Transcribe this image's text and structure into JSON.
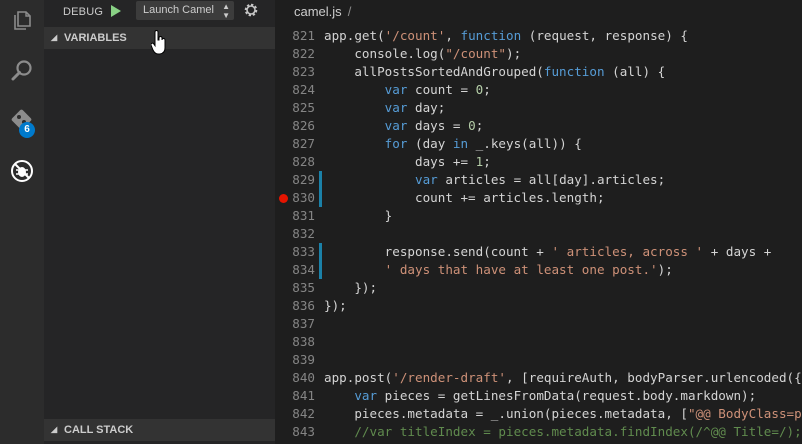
{
  "activity_bar": {
    "items": [
      {
        "icon": "files-icon"
      },
      {
        "icon": "search-icon"
      },
      {
        "icon": "git-icon",
        "badge": "6"
      },
      {
        "icon": "debug-icon"
      }
    ]
  },
  "debug": {
    "title": "DEBUG",
    "configuration": "Launch Camel",
    "sections": {
      "variables": "VARIABLES",
      "call_stack": "CALL STACK"
    }
  },
  "editor": {
    "filename": "camel.js",
    "breadcrumb_sep": "/",
    "breakpoint_line": "830",
    "lines": [
      {
        "n": "821",
        "t": "app.get('/count', function (request, response) {"
      },
      {
        "n": "822",
        "t": "    console.log(\"/count\");"
      },
      {
        "n": "823",
        "t": "    allPostsSortedAndGrouped(function (all) {"
      },
      {
        "n": "824",
        "t": "        var count = 0;"
      },
      {
        "n": "825",
        "t": "        var day;"
      },
      {
        "n": "826",
        "t": "        var days = 0;"
      },
      {
        "n": "827",
        "t": "        for (day in _.keys(all)) {"
      },
      {
        "n": "828",
        "t": "            days += 1;"
      },
      {
        "n": "829",
        "t": "            var articles = all[day].articles;"
      },
      {
        "n": "830",
        "t": "            count += articles.length;"
      },
      {
        "n": "831",
        "t": "        }"
      },
      {
        "n": "832",
        "t": ""
      },
      {
        "n": "833",
        "t": "        response.send(count + ' articles, across ' + days +"
      },
      {
        "n": "834",
        "t": "        ' days that have at least one post.');"
      },
      {
        "n": "835",
        "t": "    });"
      },
      {
        "n": "836",
        "t": "});"
      },
      {
        "n": "837",
        "t": ""
      },
      {
        "n": "838",
        "t": ""
      },
      {
        "n": "839",
        "t": ""
      },
      {
        "n": "840",
        "t": "app.post('/render-draft', [requireAuth, bodyParser.urlencoded({ ext"
      },
      {
        "n": "841",
        "t": "    var pieces = getLinesFromData(request.body.markdown);"
      },
      {
        "n": "842",
        "t": "    pieces.metadata = _.union(pieces.metadata, [\"@@ BodyClass=post\""
      },
      {
        "n": "843",
        "t": "    //var titleIndex = pieces.metadata.findIndex(/^@@ Title=/);"
      }
    ]
  },
  "colors": {
    "accent": "#007acc",
    "breakpoint": "#e51400",
    "play": "#89d185"
  }
}
